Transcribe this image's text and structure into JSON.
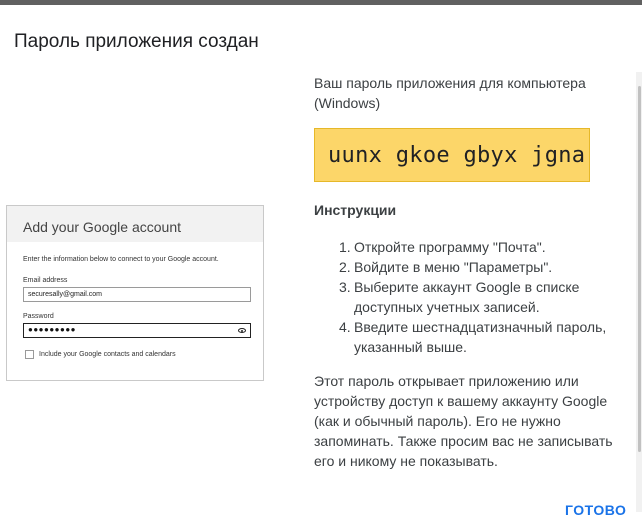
{
  "dialog": {
    "title": "Пароль приложения создан",
    "device_label": "Ваш пароль приложения для компьютера (Windows)",
    "password": "uunx gkoe gbyx jgna",
    "instructions_title": "Инструкции",
    "instructions": [
      {
        "num": "1.",
        "text": "Откройте программу \"Почта\"."
      },
      {
        "num": "2.",
        "text": "Войдите в меню \"Параметры\"."
      },
      {
        "num": "3.",
        "text": "Выберите аккаунт Google в списке доступных учетных записей."
      },
      {
        "num": "4.",
        "text": "Введите шестнадцатизначный пароль, указанный выше."
      }
    ],
    "note": "Этот пароль открывает приложению или устройству доступ к вашему аккаунту Google (как и обычный пароль). Его не нужно запоминать. Также просим вас не записывать его и никому не показывать.",
    "done_label": "ГОТОВО"
  },
  "preview": {
    "header": "Add your Google account",
    "info": "Enter the information below to connect to your Google account.",
    "email_label": "Email address",
    "email_value": "securesally@gmail.com",
    "password_label": "Password",
    "password_value": "●●●●●●●●●",
    "checkbox_label": "Include your Google contacts and calendars"
  },
  "colors": {
    "password_highlight": "#fcd669",
    "accent": "#1a73e8",
    "top_bar": "#616161"
  },
  "icons": [
    "eye-icon"
  ]
}
